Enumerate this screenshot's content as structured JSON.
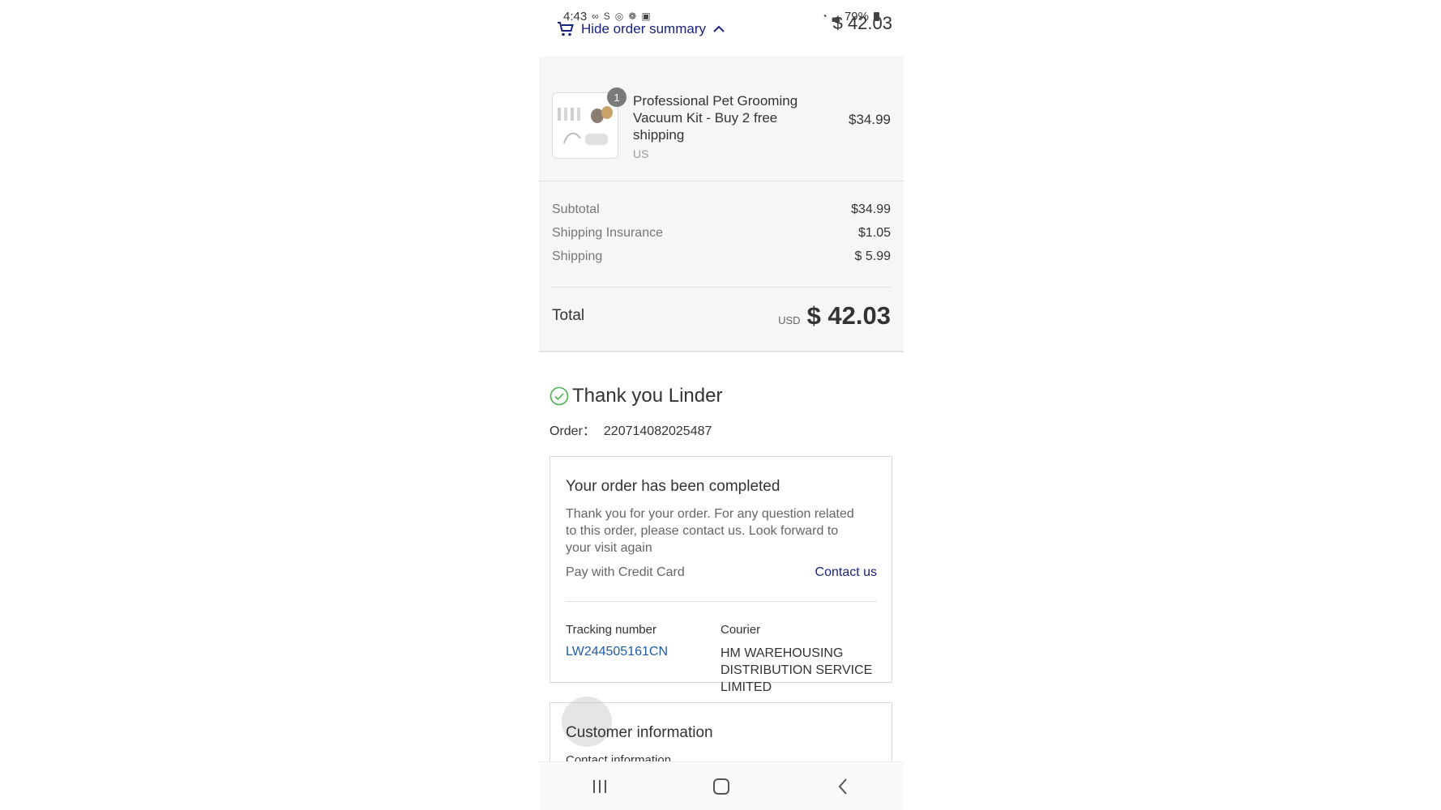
{
  "status_bar": {
    "time": "4:43",
    "battery": "79%"
  },
  "summary_header": {
    "toggle_label": "Hide order summary",
    "total_partial": "$ 42.03"
  },
  "product": {
    "quantity": "1",
    "name": "Professional Pet Grooming Vacuum Kit - Buy 2 free shipping",
    "variant": "US",
    "price": "$34.99"
  },
  "costs": [
    {
      "label": "Subtotal",
      "value": "$34.99"
    },
    {
      "label": "Shipping Insurance",
      "value": "$1.05"
    },
    {
      "label": "Shipping",
      "value": "$ 5.99"
    }
  ],
  "total": {
    "label": "Total",
    "currency": "USD",
    "value": "$ 42.03"
  },
  "thanks": {
    "title": "Thank you Linder",
    "order_label": "Order：",
    "order_number": "220714082025487"
  },
  "completed_card": {
    "title": "Your order has been completed",
    "body": "Thank you for your order. For any question related to this order, please contact us. Look forward to your visit again",
    "payment": "Pay with Credit Card",
    "contact_link": "Contact us",
    "tracking_label": "Tracking number",
    "tracking_value": "LW244505161CN",
    "courier_label": "Courier",
    "courier_value": "HM WAREHOUSING DISTRIBUTION SERVICE LIMITED"
  },
  "customer_card": {
    "title": "Customer information",
    "sub": "Contact information"
  },
  "colors": {
    "link": "#1a237e",
    "tracking_link": "#1f5ba8",
    "success": "#4caf50"
  }
}
